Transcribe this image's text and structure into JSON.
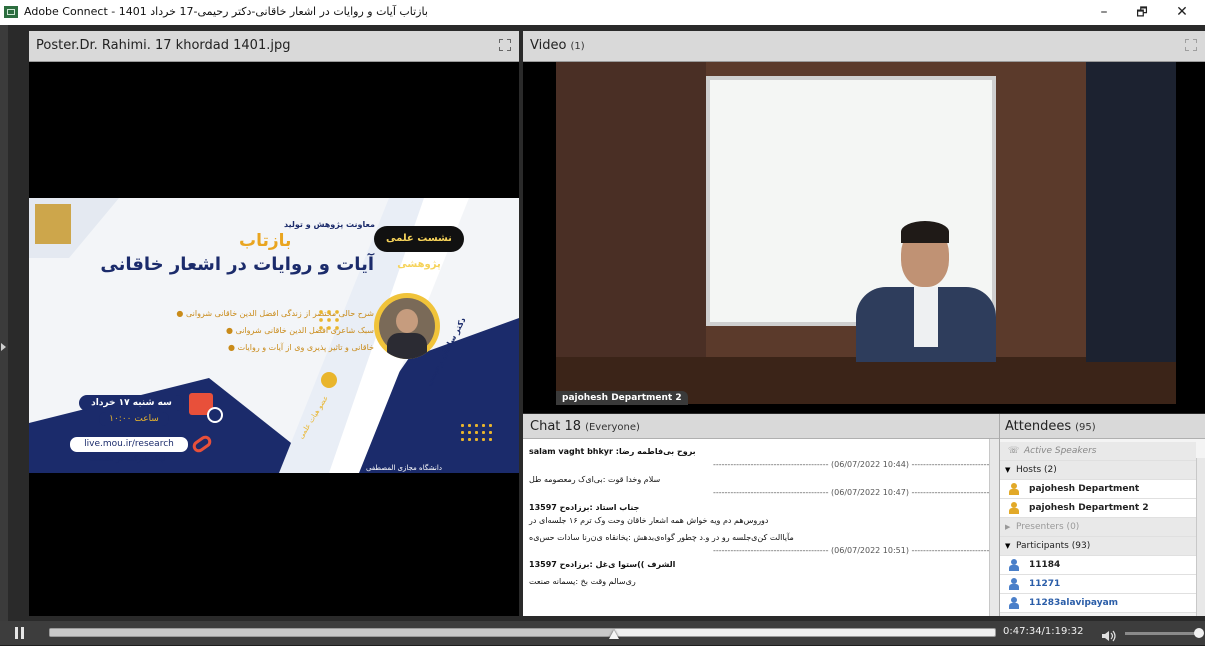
{
  "window": {
    "title": "Adobe Connect - بازتاب آیات و روایات در اشعار خاقانی-دکتر رحیمی-17 خرداد 1401",
    "minimize": "–",
    "maximize": "🗗",
    "close": "✕"
  },
  "share_pod": {
    "title": "Poster.Dr. Rahimi. 17 khordad 1401.jpg"
  },
  "poster": {
    "series": "نشست علمی پژوهشی",
    "deputy": "معاونت پژوهش و تولید",
    "kicker": "بازتاب",
    "headline": "آیات و روایات در اشعار خاقانی",
    "bullets": [
      "● شرح حالی مختصر از زندگی افضل الدین خاقانی شروانی",
      "● سبک شاعری افضل الدین خاقانی شروانی",
      "● خاقانی و تاثیر پذیری وی از آیات و روایات"
    ],
    "date_line": "سه شنبه ۱۷ خرداد ۱۴۰۱",
    "time_line": "ساعت ۱۰:۰۰",
    "url": "live.mou.ir/research",
    "join_note": "لینک شرکت در نشست",
    "speaker": "دکتر سلمان رحیمی",
    "speaker_role": "عضو هیات علمی",
    "university": "دانشگاه مجازی المصطفی",
    "colors": {
      "navy": "#1b2b6b",
      "gold": "#e9b52c",
      "white": "#ffffff"
    }
  },
  "video_pod": {
    "title": "Video",
    "count": "(1)",
    "speaker_label": "pajohesh Department 2"
  },
  "chat_pod": {
    "title": "Chat 18",
    "scope": "(Everyone)",
    "lines": [
      {
        "text": "salam vaght bhkyr :بروح بی‌فاطمه رضا",
        "bold": false
      },
      {
        "text": "---------------------------------------- (06/07/2022 10:44) ----------------------------------------",
        "bold": false,
        "sep": true
      },
      {
        "text": "سلام وخدا قوت :بی‌ای‌ک رمعصومه طل",
        "bold": false
      },
      {
        "text": "---------------------------------------- (06/07/2022 10:47) ----------------------------------------",
        "bold": false,
        "sep": true
      },
      {
        "text": "جناب استاد :برزاده‌ح 13597",
        "bold": true
      },
      {
        "text": "دوروس‌هم دم ویه خواش همه اشعار خاقان وحت وک ترم ۱۶ جلسه‌ای در",
        "bold": false
      },
      {
        "text": "مآیاالت کن‌ی‌جلسه رو در و.د چطور گواه‌ی‌بدهش :یخانقاه ی‌ن‌رنا سادات حس‌ی‌ه",
        "bold": false
      },
      {
        "text": "---------------------------------------- (06/07/2022 10:51) ----------------------------------------",
        "bold": false,
        "sep": true
      },
      {
        "text": "الشرف ))ستوا ی‌غل :برزاده‌ح 13597",
        "bold": true
      },
      {
        "text": "ری‌سالم وقت بخ :یسمانه صنعت",
        "bold": false
      }
    ]
  },
  "attendees_pod": {
    "title": "Attendees",
    "count": "(95)",
    "active_speakers": "Active Speakers",
    "hosts_label": "Hosts (2)",
    "hosts": [
      "pajohesh Department",
      "pajohesh Department 2"
    ],
    "presenters_label": "Presenters (0)",
    "participants_label": "Participants (93)",
    "participants": [
      "11184",
      "11271",
      "11283alavipayam"
    ]
  },
  "playback": {
    "time": "0:47:34/1:19:32",
    "progress": 0.598
  }
}
